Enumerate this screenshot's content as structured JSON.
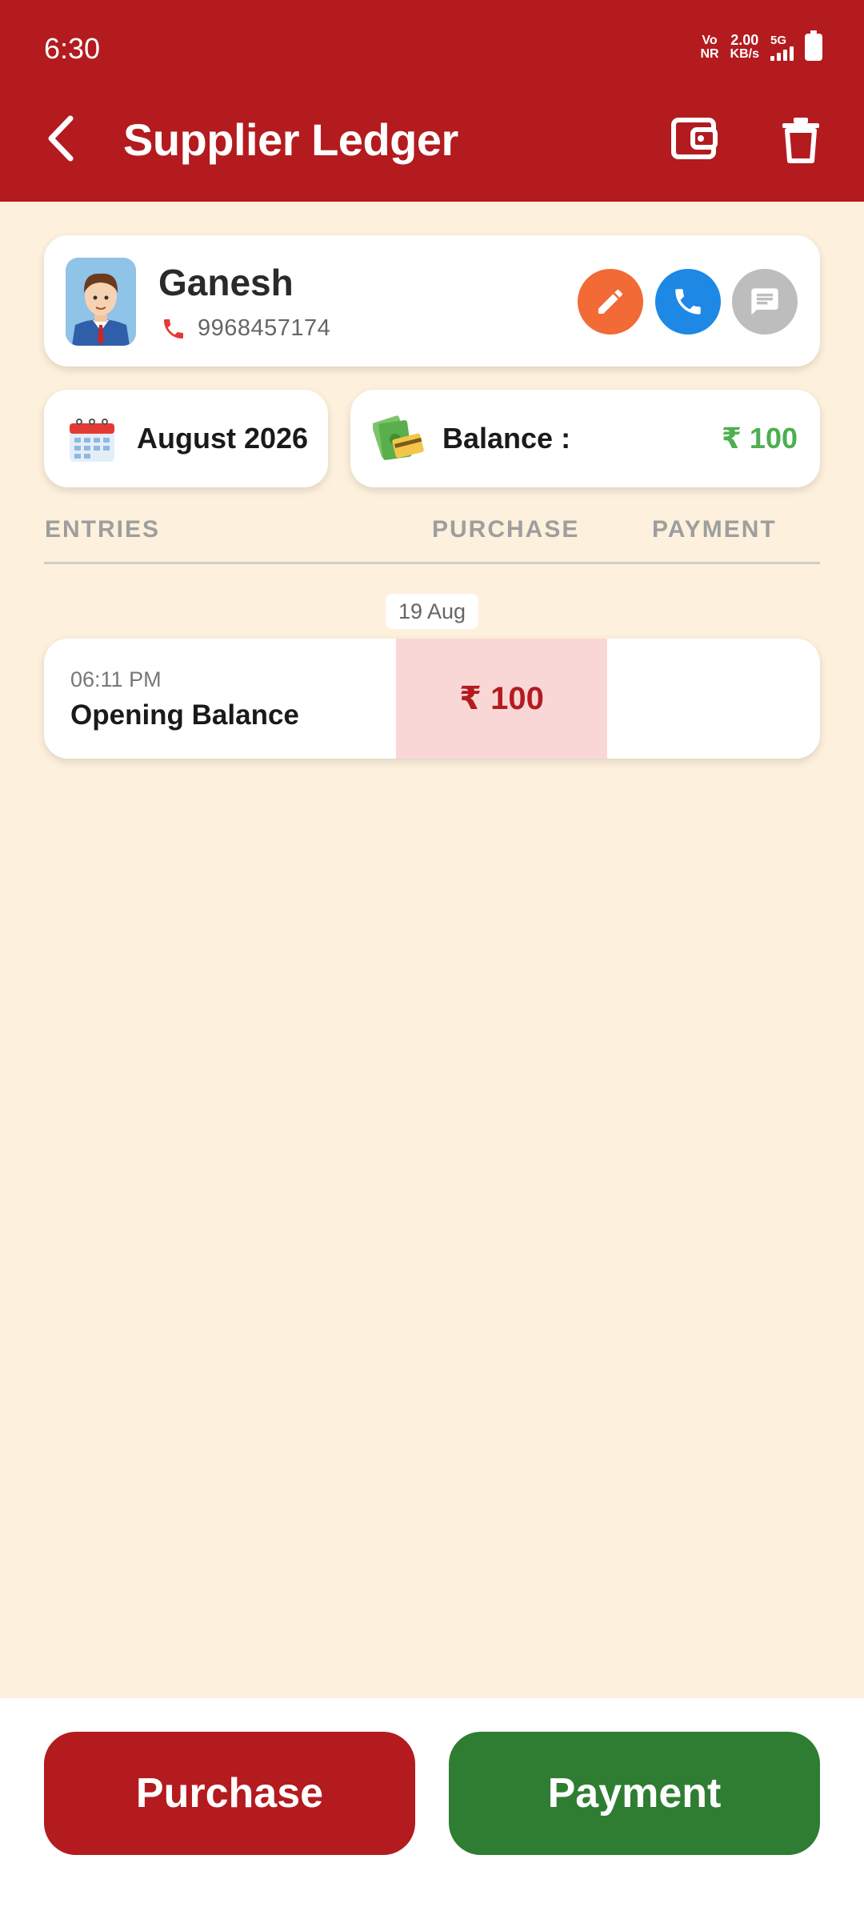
{
  "status_bar": {
    "time": "6:30",
    "vo_top": "Vo",
    "vo_bottom": "NR",
    "speed_value": "2.00",
    "speed_unit": "KB/s",
    "network": "5G"
  },
  "header": {
    "title": "Supplier Ledger",
    "back_icon": "chevron-left-icon",
    "wallet_icon": "wallet-icon",
    "delete_icon": "trash-icon"
  },
  "supplier": {
    "name": "Ganesh",
    "phone": "9968457174",
    "actions": {
      "edit_icon": "pencil-icon",
      "call_icon": "phone-icon",
      "message_icon": "message-icon"
    }
  },
  "summary": {
    "month": "August 2026",
    "balance_label": "Balance :",
    "balance_value": "₹ 100"
  },
  "columns": {
    "entries": "ENTRIES",
    "purchase": "PURCHASE",
    "payment": "PAYMENT"
  },
  "groups": [
    {
      "date": "19 Aug",
      "entries": [
        {
          "time": "06:11 PM",
          "title": "Opening Balance",
          "purchase": "₹ 100",
          "payment": ""
        }
      ]
    }
  ],
  "actions": {
    "purchase_label": "Purchase",
    "payment_label": "Payment"
  },
  "colors": {
    "primary": "#b31b1f",
    "background": "#fdf0dc",
    "balance_green": "#4caf50",
    "payment_green": "#2e7d32",
    "edit_orange": "#f26a36",
    "call_blue": "#1e88e5",
    "message_gray": "#bdbdbd",
    "purchase_cell": "#fad7d7"
  }
}
